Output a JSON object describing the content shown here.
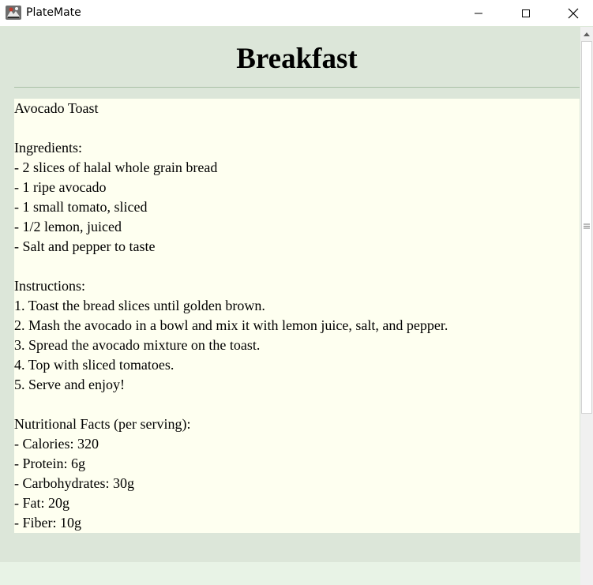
{
  "window": {
    "title": "PlateMate",
    "icon": "platemate-app-icon",
    "controls": {
      "minimize_icon": "minimize-icon",
      "maximize_icon": "maximize-icon",
      "close_icon": "close-icon"
    }
  },
  "header": {
    "title": "Breakfast"
  },
  "recipe": {
    "text": "Avocado Toast\n\nIngredients:\n- 2 slices of halal whole grain bread\n- 1 ripe avocado\n- 1 small tomato, sliced\n- 1/2 lemon, juiced\n- Salt and pepper to taste\n\nInstructions:\n1. Toast the bread slices until golden brown.\n2. Mash the avocado in a bowl and mix it with lemon juice, salt, and pepper.\n3. Spread the avocado mixture on the toast.\n4. Top with sliced tomatoes.\n5. Serve and enjoy!\n\nNutritional Facts (per serving):\n- Calories: 320\n- Protein: 6g\n- Carbohydrates: 30g\n- Fat: 20g\n- Fiber: 10g"
  },
  "colors": {
    "content_background": "#dce6d9",
    "recipe_background": "#fefff0",
    "footer_background": "#e8f3e6",
    "divider": "#a9c0a6"
  },
  "scrollbar": {
    "up_icon": "scroll-up-arrow-icon",
    "grip_icon": "scroll-grip-icon"
  }
}
